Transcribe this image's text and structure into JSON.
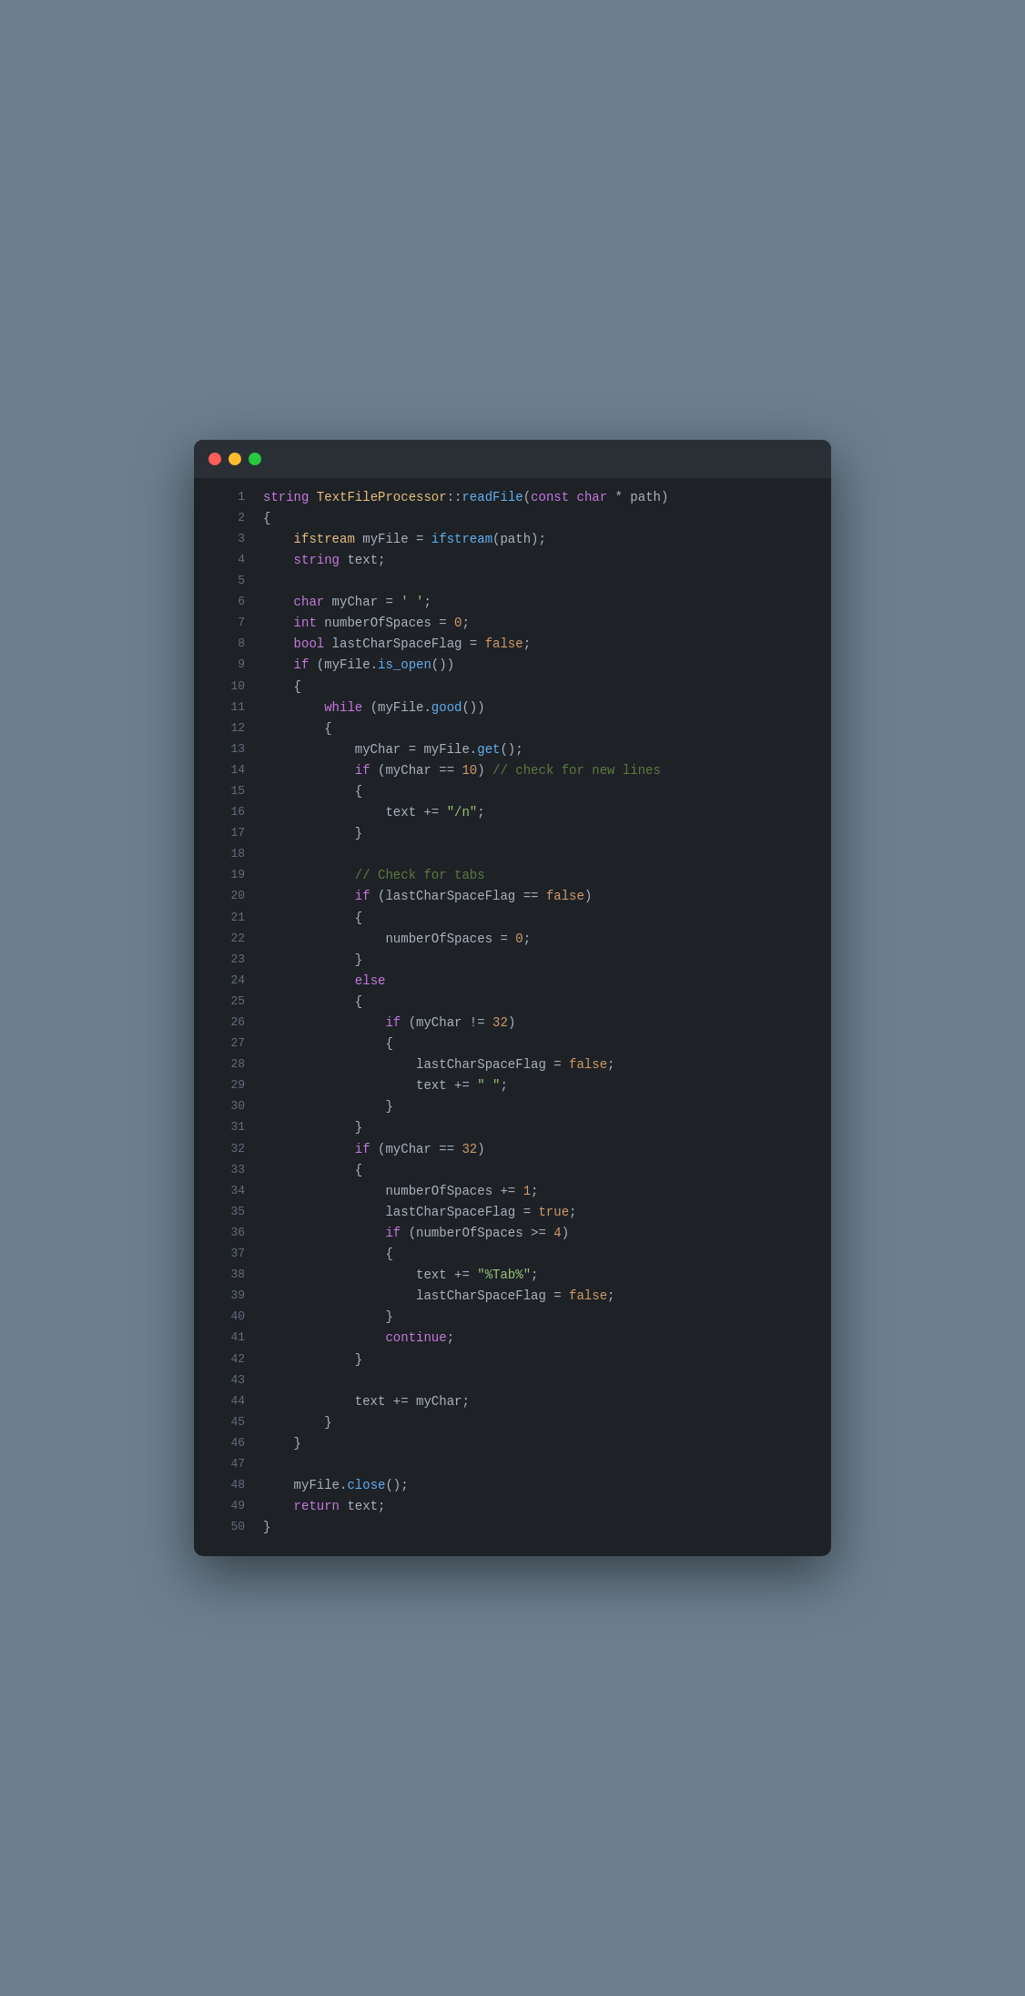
{
  "window": {
    "titlebar": {
      "dot_red": "close",
      "dot_yellow": "minimize",
      "dot_green": "maximize"
    }
  },
  "code": {
    "lines": [
      {
        "ln": 1,
        "tokens": [
          {
            "t": "kw",
            "v": "string"
          },
          {
            "t": "plain",
            "v": " "
          },
          {
            "t": "cls",
            "v": "TextFileProcessor"
          },
          {
            "t": "plain",
            "v": "::"
          },
          {
            "t": "fn",
            "v": "readFile"
          },
          {
            "t": "plain",
            "v": "("
          },
          {
            "t": "kw",
            "v": "const"
          },
          {
            "t": "plain",
            "v": " "
          },
          {
            "t": "kw",
            "v": "char"
          },
          {
            "t": "plain",
            "v": " * path)"
          }
        ]
      },
      {
        "ln": 2,
        "tokens": [
          {
            "t": "plain",
            "v": "{"
          }
        ]
      },
      {
        "ln": 3,
        "tokens": [
          {
            "t": "plain",
            "v": "    "
          },
          {
            "t": "cls",
            "v": "ifstream"
          },
          {
            "t": "plain",
            "v": " myFile = "
          },
          {
            "t": "fn",
            "v": "ifstream"
          },
          {
            "t": "plain",
            "v": "(path);"
          }
        ]
      },
      {
        "ln": 4,
        "tokens": [
          {
            "t": "plain",
            "v": "    "
          },
          {
            "t": "kw",
            "v": "string"
          },
          {
            "t": "plain",
            "v": " text;"
          }
        ]
      },
      {
        "ln": 5,
        "tokens": []
      },
      {
        "ln": 6,
        "tokens": [
          {
            "t": "plain",
            "v": "    "
          },
          {
            "t": "kw",
            "v": "char"
          },
          {
            "t": "plain",
            "v": " myChar = "
          },
          {
            "t": "str",
            "v": "' '"
          },
          {
            "t": "plain",
            "v": ";"
          }
        ]
      },
      {
        "ln": 7,
        "tokens": [
          {
            "t": "plain",
            "v": "    "
          },
          {
            "t": "kw",
            "v": "int"
          },
          {
            "t": "plain",
            "v": " numberOfSpaces = "
          },
          {
            "t": "num",
            "v": "0"
          },
          {
            "t": "plain",
            "v": ";"
          }
        ]
      },
      {
        "ln": 8,
        "tokens": [
          {
            "t": "plain",
            "v": "    "
          },
          {
            "t": "kw",
            "v": "bool"
          },
          {
            "t": "plain",
            "v": " lastCharSpaceFlag = "
          },
          {
            "t": "bool-val",
            "v": "false"
          },
          {
            "t": "plain",
            "v": ";"
          }
        ]
      },
      {
        "ln": 9,
        "tokens": [
          {
            "t": "plain",
            "v": "    "
          },
          {
            "t": "kw",
            "v": "if"
          },
          {
            "t": "plain",
            "v": " (myFile."
          },
          {
            "t": "fn",
            "v": "is_open"
          },
          {
            "t": "plain",
            "v": "())"
          }
        ]
      },
      {
        "ln": 10,
        "tokens": [
          {
            "t": "plain",
            "v": "    {"
          }
        ]
      },
      {
        "ln": 11,
        "tokens": [
          {
            "t": "plain",
            "v": "        "
          },
          {
            "t": "kw",
            "v": "while"
          },
          {
            "t": "plain",
            "v": " (myFile."
          },
          {
            "t": "fn",
            "v": "good"
          },
          {
            "t": "plain",
            "v": "())"
          }
        ]
      },
      {
        "ln": 12,
        "tokens": [
          {
            "t": "plain",
            "v": "        {"
          }
        ]
      },
      {
        "ln": 13,
        "tokens": [
          {
            "t": "plain",
            "v": "            myChar = myFile."
          },
          {
            "t": "fn",
            "v": "get"
          },
          {
            "t": "plain",
            "v": "();"
          }
        ]
      },
      {
        "ln": 14,
        "tokens": [
          {
            "t": "plain",
            "v": "            "
          },
          {
            "t": "kw",
            "v": "if"
          },
          {
            "t": "plain",
            "v": " (myChar == "
          },
          {
            "t": "num",
            "v": "10"
          },
          {
            "t": "plain",
            "v": ")"
          },
          {
            "t": "cmt",
            "v": " // check for new lines"
          }
        ]
      },
      {
        "ln": 15,
        "tokens": [
          {
            "t": "plain",
            "v": "            {"
          }
        ]
      },
      {
        "ln": 16,
        "tokens": [
          {
            "t": "plain",
            "v": "                text += "
          },
          {
            "t": "str",
            "v": "\"/n\""
          },
          {
            "t": "plain",
            "v": ";"
          }
        ]
      },
      {
        "ln": 17,
        "tokens": [
          {
            "t": "plain",
            "v": "            }"
          }
        ]
      },
      {
        "ln": 18,
        "tokens": []
      },
      {
        "ln": 19,
        "tokens": [
          {
            "t": "plain",
            "v": "            "
          },
          {
            "t": "cmt",
            "v": "// Check for tabs"
          }
        ]
      },
      {
        "ln": 20,
        "tokens": [
          {
            "t": "plain",
            "v": "            "
          },
          {
            "t": "kw",
            "v": "if"
          },
          {
            "t": "plain",
            "v": " (lastCharSpaceFlag == "
          },
          {
            "t": "bool-val",
            "v": "false"
          },
          {
            "t": "plain",
            "v": ")"
          }
        ]
      },
      {
        "ln": 21,
        "tokens": [
          {
            "t": "plain",
            "v": "            {"
          }
        ]
      },
      {
        "ln": 22,
        "tokens": [
          {
            "t": "plain",
            "v": "                numberOfSpaces = "
          },
          {
            "t": "num",
            "v": "0"
          },
          {
            "t": "plain",
            "v": ";"
          }
        ]
      },
      {
        "ln": 23,
        "tokens": [
          {
            "t": "plain",
            "v": "            }"
          }
        ]
      },
      {
        "ln": 24,
        "tokens": [
          {
            "t": "plain",
            "v": "            "
          },
          {
            "t": "kw",
            "v": "else"
          }
        ]
      },
      {
        "ln": 25,
        "tokens": [
          {
            "t": "plain",
            "v": "            {"
          }
        ]
      },
      {
        "ln": 26,
        "tokens": [
          {
            "t": "plain",
            "v": "                "
          },
          {
            "t": "kw",
            "v": "if"
          },
          {
            "t": "plain",
            "v": " (myChar != "
          },
          {
            "t": "num",
            "v": "32"
          },
          {
            "t": "plain",
            "v": ")"
          }
        ]
      },
      {
        "ln": 27,
        "tokens": [
          {
            "t": "plain",
            "v": "                {"
          }
        ]
      },
      {
        "ln": 28,
        "tokens": [
          {
            "t": "plain",
            "v": "                    lastCharSpaceFlag = "
          },
          {
            "t": "bool-val",
            "v": "false"
          },
          {
            "t": "plain",
            "v": ";"
          }
        ]
      },
      {
        "ln": 29,
        "tokens": [
          {
            "t": "plain",
            "v": "                    text += "
          },
          {
            "t": "str",
            "v": "\" \""
          },
          {
            "t": "plain",
            "v": ";"
          }
        ]
      },
      {
        "ln": 30,
        "tokens": [
          {
            "t": "plain",
            "v": "                }"
          }
        ]
      },
      {
        "ln": 31,
        "tokens": [
          {
            "t": "plain",
            "v": "            }"
          }
        ]
      },
      {
        "ln": 32,
        "tokens": [
          {
            "t": "plain",
            "v": "            "
          },
          {
            "t": "kw",
            "v": "if"
          },
          {
            "t": "plain",
            "v": " (myChar == "
          },
          {
            "t": "num",
            "v": "32"
          },
          {
            "t": "plain",
            "v": ")"
          }
        ]
      },
      {
        "ln": 33,
        "tokens": [
          {
            "t": "plain",
            "v": "            {"
          }
        ]
      },
      {
        "ln": 34,
        "tokens": [
          {
            "t": "plain",
            "v": "                numberOfSpaces += "
          },
          {
            "t": "num",
            "v": "1"
          },
          {
            "t": "plain",
            "v": ";"
          }
        ]
      },
      {
        "ln": 35,
        "tokens": [
          {
            "t": "plain",
            "v": "                lastCharSpaceFlag = "
          },
          {
            "t": "bool-val",
            "v": "true"
          },
          {
            "t": "plain",
            "v": ";"
          }
        ]
      },
      {
        "ln": 36,
        "tokens": [
          {
            "t": "plain",
            "v": "                "
          },
          {
            "t": "kw",
            "v": "if"
          },
          {
            "t": "plain",
            "v": " (numberOfSpaces >= "
          },
          {
            "t": "num",
            "v": "4"
          },
          {
            "t": "plain",
            "v": ")"
          }
        ]
      },
      {
        "ln": 37,
        "tokens": [
          {
            "t": "plain",
            "v": "                {"
          }
        ]
      },
      {
        "ln": 38,
        "tokens": [
          {
            "t": "plain",
            "v": "                    text += "
          },
          {
            "t": "str",
            "v": "\"%Tab%\""
          },
          {
            "t": "plain",
            "v": ";"
          }
        ]
      },
      {
        "ln": 39,
        "tokens": [
          {
            "t": "plain",
            "v": "                    lastCharSpaceFlag = "
          },
          {
            "t": "bool-val",
            "v": "false"
          },
          {
            "t": "plain",
            "v": ";"
          }
        ]
      },
      {
        "ln": 40,
        "tokens": [
          {
            "t": "plain",
            "v": "                }"
          }
        ]
      },
      {
        "ln": 41,
        "tokens": [
          {
            "t": "plain",
            "v": "                "
          },
          {
            "t": "kw",
            "v": "continue"
          },
          {
            "t": "plain",
            "v": ";"
          }
        ]
      },
      {
        "ln": 42,
        "tokens": [
          {
            "t": "plain",
            "v": "            }"
          }
        ]
      },
      {
        "ln": 43,
        "tokens": []
      },
      {
        "ln": 44,
        "tokens": [
          {
            "t": "plain",
            "v": "            text += myChar;"
          }
        ]
      },
      {
        "ln": 45,
        "tokens": [
          {
            "t": "plain",
            "v": "        }"
          }
        ]
      },
      {
        "ln": 46,
        "tokens": [
          {
            "t": "plain",
            "v": "    }"
          }
        ]
      },
      {
        "ln": 47,
        "tokens": []
      },
      {
        "ln": 48,
        "tokens": [
          {
            "t": "plain",
            "v": "    myFile."
          },
          {
            "t": "fn",
            "v": "close"
          },
          {
            "t": "plain",
            "v": "();"
          }
        ]
      },
      {
        "ln": 49,
        "tokens": [
          {
            "t": "plain",
            "v": "    "
          },
          {
            "t": "kw",
            "v": "return"
          },
          {
            "t": "plain",
            "v": " text;"
          }
        ]
      },
      {
        "ln": 50,
        "tokens": [
          {
            "t": "plain",
            "v": "}"
          }
        ]
      }
    ]
  }
}
